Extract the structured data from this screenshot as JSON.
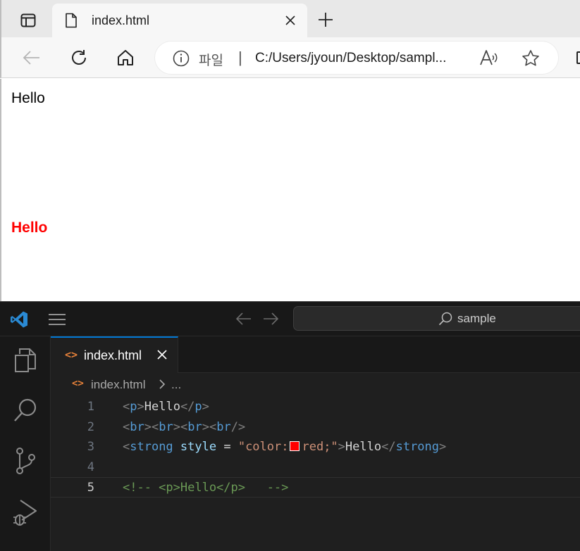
{
  "browser": {
    "tab_title": "index.html",
    "address_scheme_label": "파일",
    "address_separator": "|",
    "address_url": "C:/Users/jyoun/Desktop/sampl..."
  },
  "page": {
    "paragraph_text": "Hello",
    "strong_text": "Hello",
    "strong_color": "#ff0000"
  },
  "vscode": {
    "command_center": "sample",
    "editor_tab_title": "index.html",
    "breadcrumb_file": "index.html",
    "breadcrumb_more": "...",
    "active_line": 5,
    "lines": [
      {
        "number": "1",
        "tokens": [
          [
            "t-p",
            "<"
          ],
          [
            "t-tag",
            "p"
          ],
          [
            "t-p",
            ">"
          ],
          [
            "t-text",
            "Hello"
          ],
          [
            "t-p",
            "</"
          ],
          [
            "t-tag",
            "p"
          ],
          [
            "t-p",
            ">"
          ]
        ]
      },
      {
        "number": "2",
        "tokens": [
          [
            "t-p",
            "<"
          ],
          [
            "t-tag",
            "br"
          ],
          [
            "t-p",
            ">"
          ],
          [
            "t-p",
            "<"
          ],
          [
            "t-tag",
            "br"
          ],
          [
            "t-p",
            ">"
          ],
          [
            "t-p",
            "<"
          ],
          [
            "t-tag",
            "br"
          ],
          [
            "t-p",
            ">"
          ],
          [
            "t-p",
            "<"
          ],
          [
            "t-tag",
            "br"
          ],
          [
            "t-p",
            "/>"
          ]
        ]
      },
      {
        "number": "3",
        "tokens": [
          [
            "t-p",
            "<"
          ],
          [
            "t-tag",
            "strong"
          ],
          [
            "t-text",
            " "
          ],
          [
            "t-attr",
            "style"
          ],
          [
            "t-text",
            " = "
          ],
          [
            "t-str",
            "\"color:"
          ],
          [
            "swatch",
            ""
          ],
          [
            "t-str",
            "red;\""
          ],
          [
            "t-p",
            ">"
          ],
          [
            "t-text",
            "Hello"
          ],
          [
            "t-p",
            "</"
          ],
          [
            "t-tag",
            "strong"
          ],
          [
            "t-p",
            ">"
          ]
        ]
      },
      {
        "number": "4",
        "tokens": []
      },
      {
        "number": "5",
        "tokens": [
          [
            "t-cmt",
            "<!-- <p>Hello</p>   -->"
          ]
        ]
      }
    ]
  },
  "colors": {
    "vscode_accent": "#0078d4",
    "html_icon": "#e8823a"
  }
}
